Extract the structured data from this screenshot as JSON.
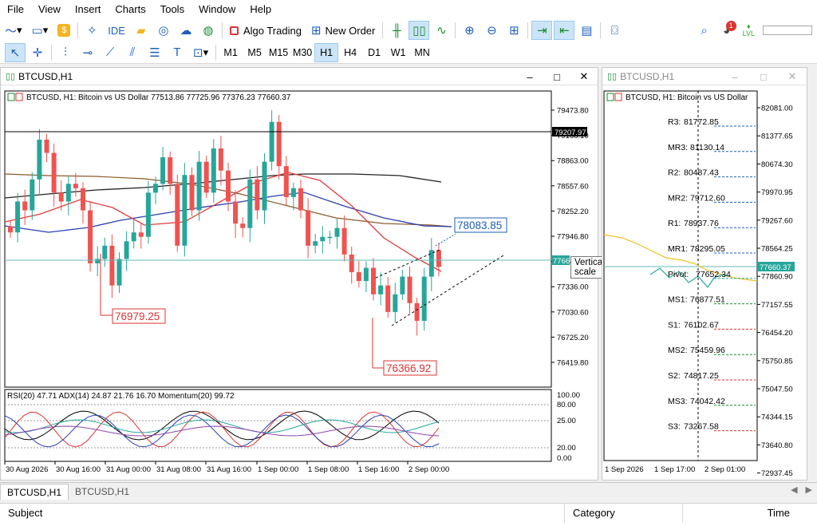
{
  "menu": [
    "File",
    "View",
    "Insert",
    "Charts",
    "Tools",
    "Window",
    "Help"
  ],
  "toolbar": {
    "ide_label": "IDE",
    "algo_label": "Algo Trading",
    "new_order_label": "New Order",
    "notification_count": "1",
    "level_label": "LVL"
  },
  "timeframes": [
    "M1",
    "M5",
    "M15",
    "M30",
    "H1",
    "H4",
    "D1",
    "W1",
    "MN"
  ],
  "active_timeframe": "H1",
  "main_window": {
    "title": "BTCUSD,H1",
    "info": "BTCUSD, H1:  Bitcoin vs US Dollar  77513.86 77725.96 77376.23 77660.37",
    "price_ticks": [
      "79473.80",
      "79168.10",
      "78863.00",
      "78557.60",
      "78252.20",
      "77946.80",
      "77641.40",
      "77336.00",
      "77030.60",
      "76725.20",
      "76419.80"
    ],
    "hline_label": "79207.97",
    "current_price_tag": "7766",
    "label_high": "78083.85",
    "label_low1": "76979.25",
    "label_low2": "76366.92",
    "tooltip": "Vertical scale",
    "indicator_info": "RSI(20) 47.71 ADX(14) 24.87 21.76 16.70 Momentum(20) 99.72",
    "ind_ticks": [
      "100.00",
      "80.00",
      "25.00",
      "20.00",
      "0.00"
    ],
    "time_ticks": [
      "30 Aug 2026",
      "30 Aug 16:00",
      "31 Aug 00:00",
      "31 Aug 08:00",
      "31 Aug 16:00",
      "1 Sep 00:00",
      "1 Sep 08:00",
      "1 Sep 16:00",
      "2 Sep 00:00"
    ]
  },
  "side_window": {
    "title": "BTCUSD,H1",
    "info": "BTCUSD, H1:  Bitcoin vs US Dollar",
    "price_ticks": [
      "82081.00",
      "81377.65",
      "80674.30",
      "79970.95",
      "79267.60",
      "78564.25",
      "77860.90",
      "77157.55",
      "76454.20",
      "75750.85",
      "75047.50",
      "74344.15",
      "73640.80",
      "72937.45"
    ],
    "current_price_tag": "77660.37",
    "pivots": [
      {
        "name": "R3:",
        "value": "81772.85"
      },
      {
        "name": "MR3:",
        "value": "81130.14"
      },
      {
        "name": "R2:",
        "value": "80487.43"
      },
      {
        "name": "MR2:",
        "value": "79712.60"
      },
      {
        "name": "R1:",
        "value": "78937.76"
      },
      {
        "name": "MR1:",
        "value": "78295.05"
      },
      {
        "name": "Pivot:",
        "value": "77652.34"
      },
      {
        "name": "MS1:",
        "value": "76877.51"
      },
      {
        "name": "S1:",
        "value": "76102.67"
      },
      {
        "name": "MS2:",
        "value": "75459.96"
      },
      {
        "name": "S2:",
        "value": "74817.25"
      },
      {
        "name": "MS3:",
        "value": "74042.42"
      },
      {
        "name": "S3:",
        "value": "73267.58"
      }
    ],
    "time_ticks": [
      "1 Sep 2026",
      "1 Sep 17:00",
      "2 Sep 01:00"
    ]
  },
  "tabs": [
    "BTCUSD,H1",
    "BTCUSD,H1"
  ],
  "table_headers": {
    "subject": "Subject",
    "category": "Category",
    "time": "Time"
  },
  "colors": {
    "bull": "#26a69a",
    "bear": "#ef5350",
    "accent": "#1d5fb8"
  },
  "chart_data": {
    "type": "candlestick",
    "symbol": "BTCUSD",
    "timeframe": "H1",
    "ylim": [
      76300,
      79650
    ],
    "open": [
      78120,
      78050,
      78400,
      78300,
      78650,
      79100,
      78950,
      78500,
      78400,
      78600,
      78550,
      78300,
      77700,
      77750,
      77900,
      77450,
      77750,
      77950,
      78050,
      78000,
      78500,
      78600,
      78900,
      78600,
      77900,
      78700,
      78300,
      78850,
      78500,
      79000,
      78750,
      78400,
      78150,
      78100,
      78650,
      78300,
      78850,
      79300,
      78800,
      78450,
      78550,
      78300,
      77900,
      77950,
      78000,
      78000,
      78100,
      77800,
      77600,
      77500,
      77650,
      77350,
      77450,
      77150,
      77350,
      77550,
      77250,
      77050,
      77550,
      77850
    ],
    "close": [
      78050,
      78400,
      78300,
      78650,
      79100,
      78950,
      78500,
      78400,
      78600,
      78550,
      78300,
      77700,
      77750,
      77900,
      77450,
      77750,
      77950,
      78050,
      78000,
      78500,
      78600,
      78900,
      78600,
      77900,
      78700,
      78300,
      78850,
      78500,
      79000,
      78750,
      78400,
      78150,
      78100,
      78650,
      78300,
      78850,
      79300,
      78800,
      78450,
      78550,
      78300,
      77900,
      77950,
      78000,
      78000,
      78100,
      77800,
      77600,
      77500,
      77650,
      77350,
      77450,
      77150,
      77350,
      77550,
      77250,
      77050,
      77550,
      77850,
      77660
    ]
  }
}
